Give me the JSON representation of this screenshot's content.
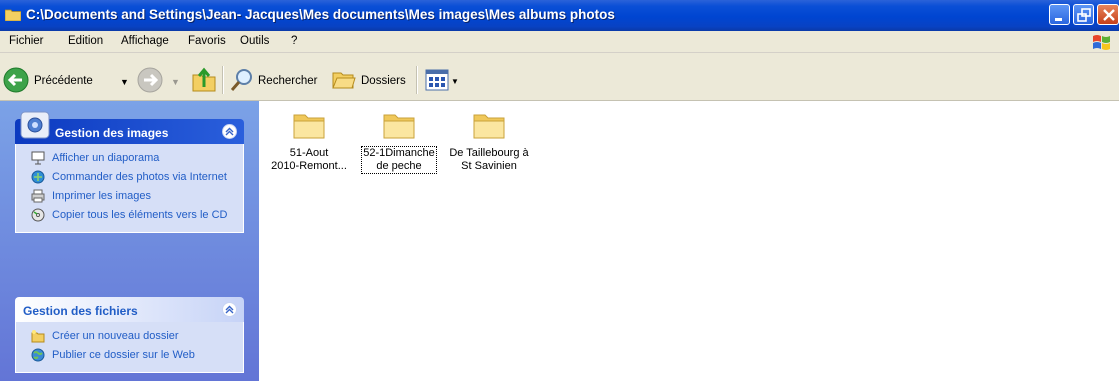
{
  "window": {
    "title": "C:\\Documents and Settings\\Jean- Jacques\\Mes documents\\Mes images\\Mes albums photos"
  },
  "menu": [
    "Fichier",
    "Edition",
    "Affichage",
    "Favoris",
    "Outils",
    "?"
  ],
  "toolbar": {
    "back_label": "Précédente",
    "search_label": "Rechercher",
    "folders_label": "Dossiers"
  },
  "panels": {
    "images": {
      "title": "Gestion des images",
      "tasks": [
        {
          "label": "Afficher un diaporama",
          "icon": "slideshow-icon"
        },
        {
          "label": "Commander des photos via Internet",
          "icon": "order-photos-icon"
        },
        {
          "label": "Imprimer les images",
          "icon": "printer-icon"
        },
        {
          "label": "Copier tous les éléments vers le CD",
          "icon": "cd-icon"
        }
      ]
    },
    "files": {
      "title": "Gestion des fichiers",
      "tasks": [
        {
          "label": "Créer un nouveau dossier",
          "icon": "new-folder-icon"
        },
        {
          "label": "Publier ce dossier sur le Web",
          "icon": "web-publish-icon"
        }
      ]
    }
  },
  "folders": [
    {
      "name": "51-Aout 2010-Remont...",
      "line1": "51-Aout",
      "line2": "2010-Remont..."
    },
    {
      "name": "52-1Dimanche de peche",
      "line1": "52-1Dimanche",
      "line2": "de peche"
    },
    {
      "name": "De Taillebourg à St Savinien",
      "line1": "De Taillebourg à",
      "line2": "St Savinien"
    }
  ],
  "colors": {
    "titlebar": "#0045d1",
    "task_link": "#215dc6",
    "panel_bg": "#d6dff7",
    "left_pane": "#7ba2e7",
    "folder": "#f5d77a"
  }
}
